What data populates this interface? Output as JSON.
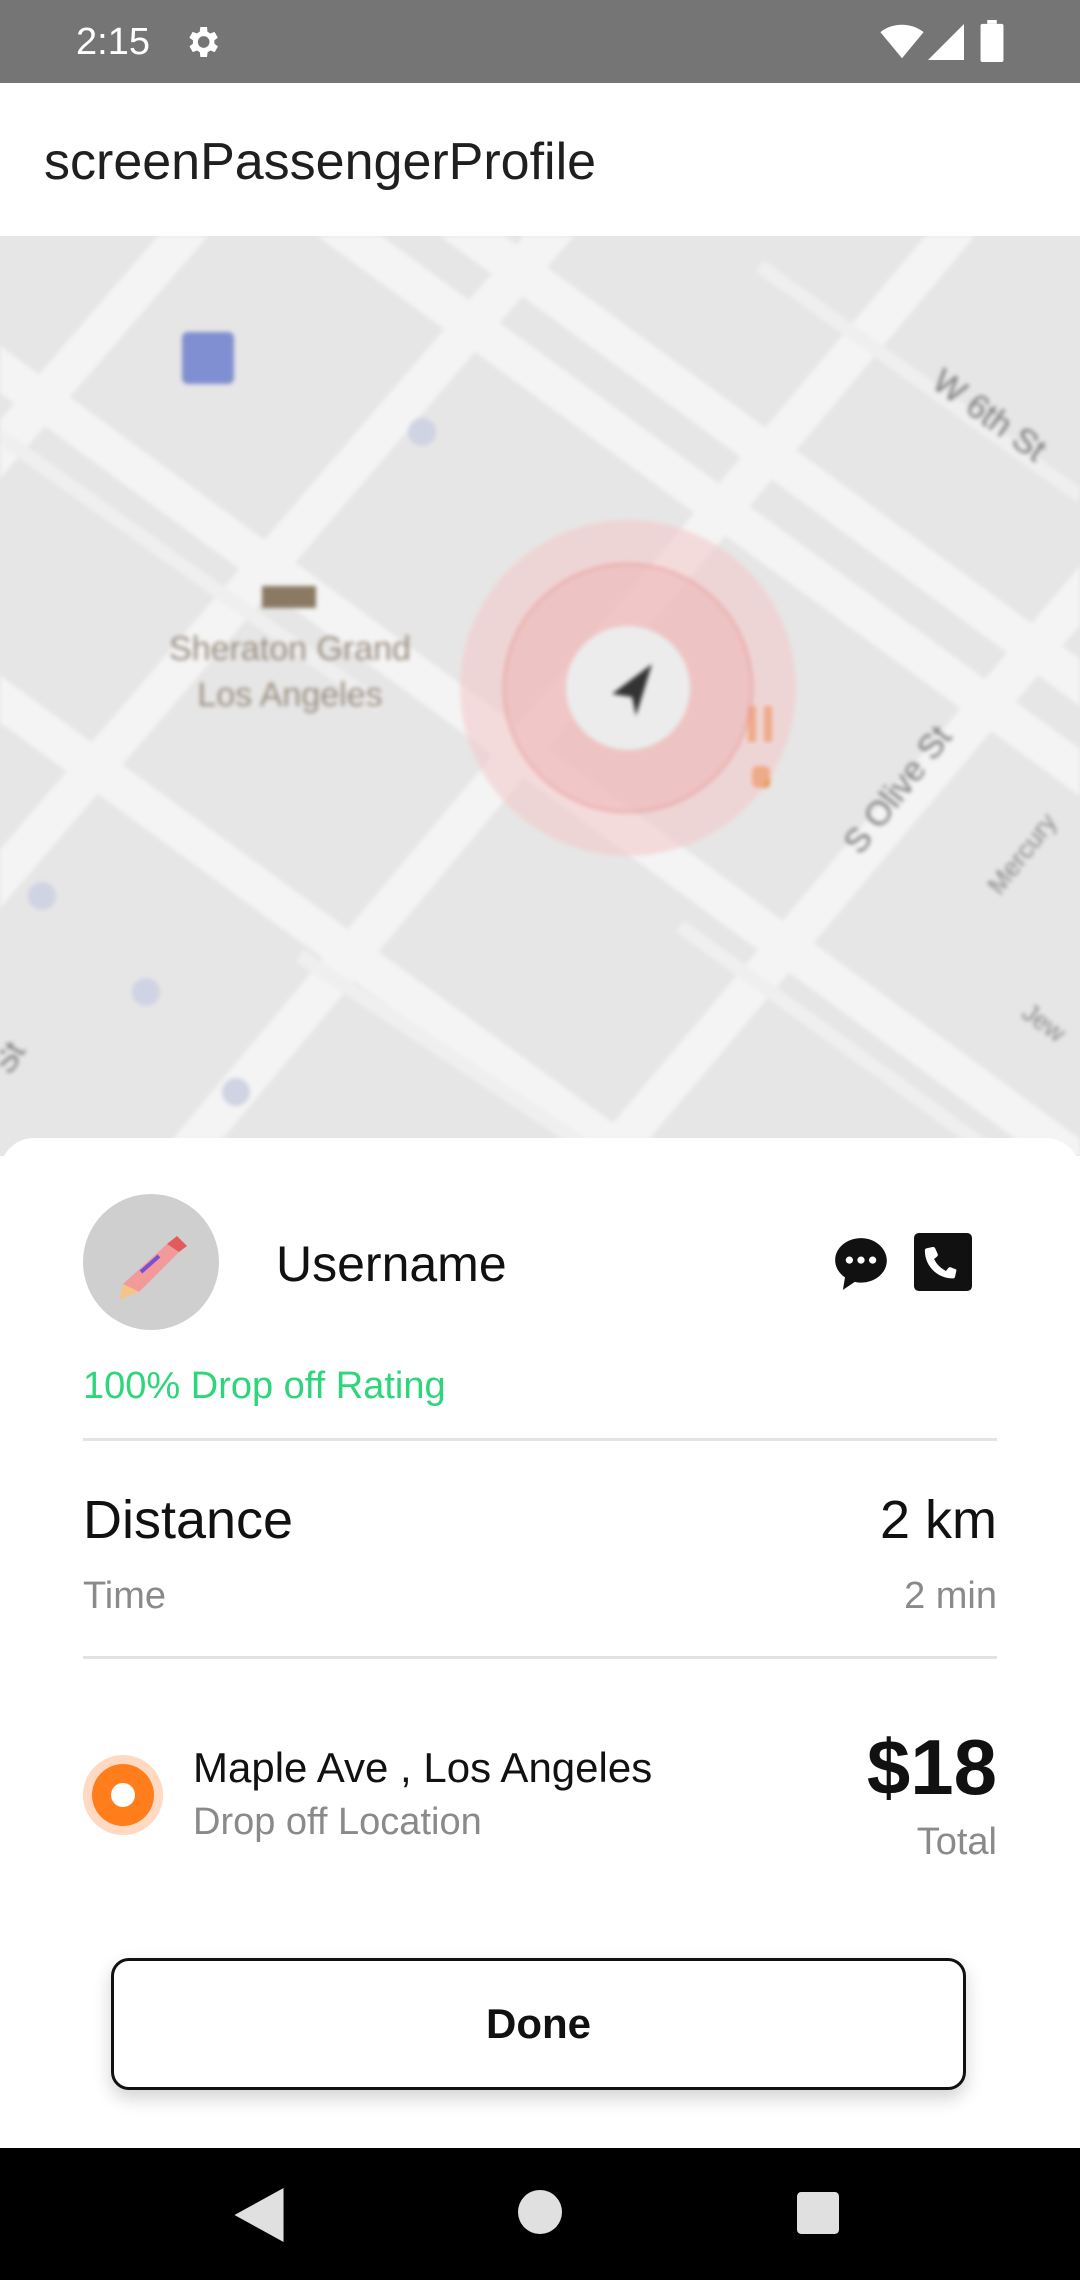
{
  "status_bar": {
    "time": "2:15",
    "icons": [
      "gear-icon",
      "wifi-icon",
      "signal-icon",
      "battery-icon"
    ]
  },
  "app_bar": {
    "title": "screenPassengerProfile"
  },
  "map": {
    "labels": {
      "hotel": "Sheraton Grand\nLos Angeles",
      "street_w6th": "W 6th St",
      "street_olive": "S Olive St",
      "street_mercury": "Mercury",
      "street_left": "St",
      "street_jewel": "Jew"
    }
  },
  "passenger": {
    "username": "Username",
    "rating": "100% Drop off Rating",
    "actions": [
      "chat-icon",
      "phone-icon"
    ]
  },
  "trip": {
    "distance_label": "Distance",
    "distance_value": "2 km",
    "time_label": "Time",
    "time_value": "2 min",
    "drop_address": "Maple Ave , Los Angeles",
    "drop_label": "Drop off Location",
    "price": "$18",
    "price_label": "Total"
  },
  "done_button": {
    "label": "Done"
  },
  "colors": {
    "accent_green": "#2ed67b",
    "accent_orange": "#ff7e1b"
  }
}
